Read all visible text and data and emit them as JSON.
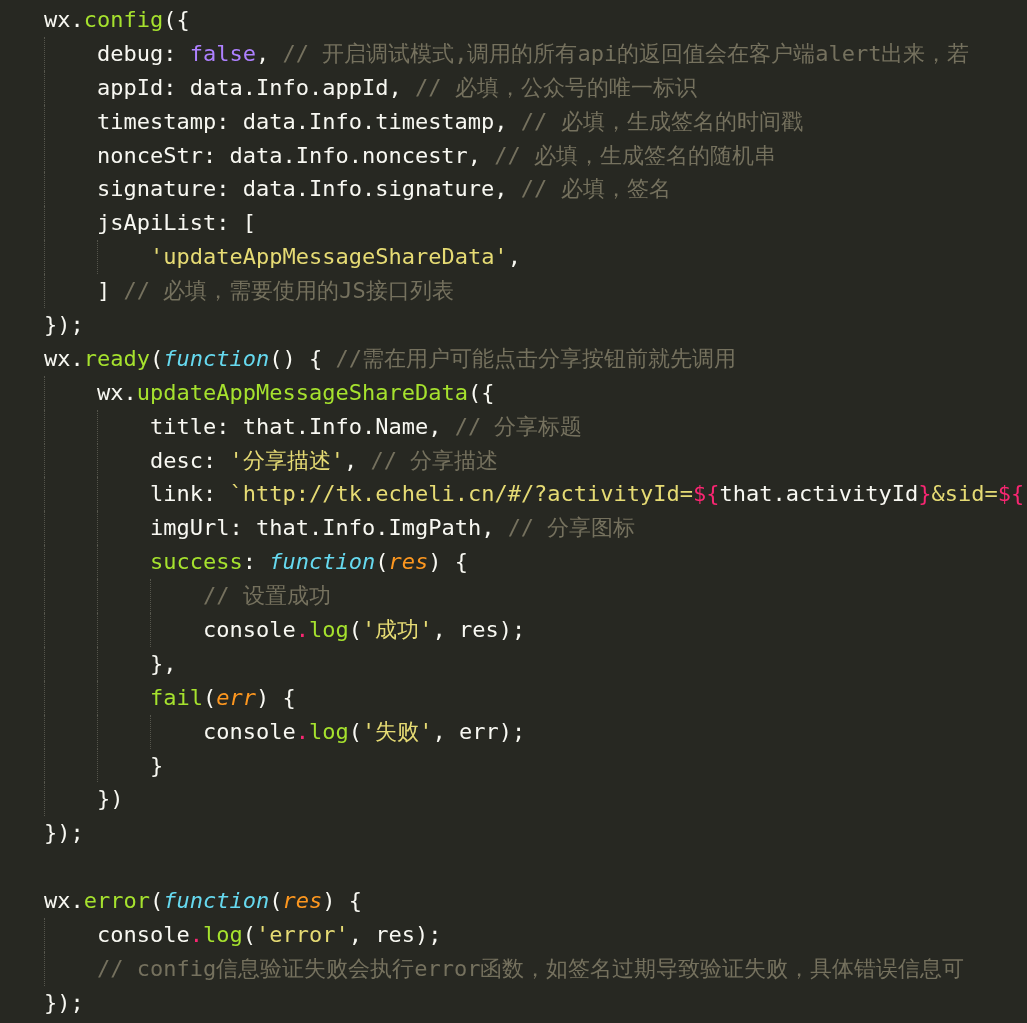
{
  "editor": {
    "lines": [
      {
        "kind": "code",
        "tokens": [
          {
            "text": "wx.",
            "kind": "plain"
          },
          {
            "text": "config",
            "kind": "func"
          },
          {
            "text": "({",
            "kind": "plain"
          }
        ],
        "children": [
          {
            "tokens": [
              {
                "text": "debug: ",
                "kind": "plain"
              },
              {
                "text": "false",
                "kind": "bool"
              },
              {
                "text": ", ",
                "kind": "plain"
              },
              {
                "text": "// 开启调试模式,调用的所有api的返回值会在客户端alert出来，若",
                "kind": "comment"
              }
            ]
          },
          {
            "tokens": [
              {
                "text": "appId: data.Info.appId, ",
                "kind": "plain"
              },
              {
                "text": "// 必填，公众号的唯一标识",
                "kind": "comment"
              }
            ]
          },
          {
            "tokens": [
              {
                "text": "timestamp: data.Info.timestamp, ",
                "kind": "plain"
              },
              {
                "text": "// 必填，生成签名的时间戳",
                "kind": "comment"
              }
            ]
          },
          {
            "tokens": [
              {
                "text": "nonceStr: data.Info.noncestr, ",
                "kind": "plain"
              },
              {
                "text": "// 必填，生成签名的随机串",
                "kind": "comment"
              }
            ]
          },
          {
            "tokens": [
              {
                "text": "signature: data.Info.signature, ",
                "kind": "plain"
              },
              {
                "text": "// 必填，签名",
                "kind": "comment"
              }
            ]
          },
          {
            "tokens": [
              {
                "text": "jsApiList: [",
                "kind": "plain"
              }
            ],
            "children": [
              {
                "tokens": [
                  {
                    "text": "'updateAppMessageShareData'",
                    "kind": "string"
                  },
                  {
                    "text": ",",
                    "kind": "plain"
                  }
                ]
              }
            ]
          },
          {
            "tokens": [
              {
                "text": "] ",
                "kind": "plain"
              },
              {
                "text": "// 必填，需要使用的JS接口列表",
                "kind": "comment"
              }
            ]
          }
        ]
      },
      {
        "kind": "code",
        "tokens": [
          {
            "text": "});",
            "kind": "plain"
          }
        ]
      },
      {
        "kind": "code",
        "tokens": [
          {
            "text": "wx.",
            "kind": "plain"
          },
          {
            "text": "ready",
            "kind": "func"
          },
          {
            "text": "(",
            "kind": "plain"
          },
          {
            "text": "function",
            "kind": "keyword"
          },
          {
            "text": "() { ",
            "kind": "plain"
          },
          {
            "text": "//需在用户可能点击分享按钮前就先调用",
            "kind": "comment"
          }
        ],
        "children": [
          {
            "tokens": [
              {
                "text": "wx.",
                "kind": "plain"
              },
              {
                "text": "updateAppMessageShareData",
                "kind": "func"
              },
              {
                "text": "({",
                "kind": "plain"
              }
            ],
            "children": [
              {
                "tokens": [
                  {
                    "text": "title: that.Info.Name, ",
                    "kind": "plain"
                  },
                  {
                    "text": "// 分享标题",
                    "kind": "comment"
                  }
                ]
              },
              {
                "tokens": [
                  {
                    "text": "desc: ",
                    "kind": "plain"
                  },
                  {
                    "text": "'分享描述'",
                    "kind": "string"
                  },
                  {
                    "text": ", ",
                    "kind": "plain"
                  },
                  {
                    "text": "// 分享描述",
                    "kind": "comment"
                  }
                ]
              },
              {
                "tokens": [
                  {
                    "text": "link: ",
                    "kind": "plain"
                  },
                  {
                    "text": "`http://tk.echeli.cn/#/?activityId=",
                    "kind": "string"
                  },
                  {
                    "text": "${",
                    "kind": "operator"
                  },
                  {
                    "text": "that.activityId",
                    "kind": "plain"
                  },
                  {
                    "text": "}",
                    "kind": "operator"
                  },
                  {
                    "text": "&sid=",
                    "kind": "string"
                  },
                  {
                    "text": "${",
                    "kind": "operator"
                  }
                ]
              },
              {
                "tokens": [
                  {
                    "text": "imgUrl: that.Info.ImgPath, ",
                    "kind": "plain"
                  },
                  {
                    "text": "// 分享图标",
                    "kind": "comment"
                  }
                ]
              },
              {
                "tokens": [
                  {
                    "text": "success",
                    "kind": "func"
                  },
                  {
                    "text": ": ",
                    "kind": "plain"
                  },
                  {
                    "text": "function",
                    "kind": "keyword"
                  },
                  {
                    "text": "(",
                    "kind": "plain"
                  },
                  {
                    "text": "res",
                    "kind": "param"
                  },
                  {
                    "text": ") {",
                    "kind": "plain"
                  }
                ],
                "children": [
                  {
                    "tokens": [
                      {
                        "text": "// 设置成功",
                        "kind": "comment"
                      }
                    ]
                  },
                  {
                    "tokens": [
                      {
                        "text": "console",
                        "kind": "plain"
                      },
                      {
                        "text": ".",
                        "kind": "operator"
                      },
                      {
                        "text": "log",
                        "kind": "func"
                      },
                      {
                        "text": "(",
                        "kind": "plain"
                      },
                      {
                        "text": "'成功'",
                        "kind": "string"
                      },
                      {
                        "text": ", res);",
                        "kind": "plain"
                      }
                    ]
                  }
                ]
              },
              {
                "tokens": [
                  {
                    "text": "},",
                    "kind": "plain"
                  }
                ]
              },
              {
                "tokens": [
                  {
                    "text": "fail",
                    "kind": "func"
                  },
                  {
                    "text": "(",
                    "kind": "plain"
                  },
                  {
                    "text": "err",
                    "kind": "param"
                  },
                  {
                    "text": ") {",
                    "kind": "plain"
                  }
                ],
                "children": [
                  {
                    "tokens": [
                      {
                        "text": "console",
                        "kind": "plain"
                      },
                      {
                        "text": ".",
                        "kind": "operator"
                      },
                      {
                        "text": "log",
                        "kind": "func"
                      },
                      {
                        "text": "(",
                        "kind": "plain"
                      },
                      {
                        "text": "'失败'",
                        "kind": "string"
                      },
                      {
                        "text": ", err);",
                        "kind": "plain"
                      }
                    ]
                  }
                ]
              },
              {
                "tokens": [
                  {
                    "text": "}",
                    "kind": "plain"
                  }
                ]
              }
            ]
          },
          {
            "tokens": [
              {
                "text": "})",
                "kind": "plain"
              }
            ]
          }
        ]
      },
      {
        "kind": "code",
        "tokens": [
          {
            "text": "});",
            "kind": "plain"
          }
        ]
      },
      {
        "kind": "blank"
      },
      {
        "kind": "code",
        "tokens": [
          {
            "text": "wx.",
            "kind": "plain"
          },
          {
            "text": "error",
            "kind": "func"
          },
          {
            "text": "(",
            "kind": "plain"
          },
          {
            "text": "function",
            "kind": "keyword"
          },
          {
            "text": "(",
            "kind": "plain"
          },
          {
            "text": "res",
            "kind": "param"
          },
          {
            "text": ") {",
            "kind": "plain"
          }
        ],
        "children": [
          {
            "tokens": [
              {
                "text": "console",
                "kind": "plain"
              },
              {
                "text": ".",
                "kind": "operator"
              },
              {
                "text": "log",
                "kind": "func"
              },
              {
                "text": "(",
                "kind": "plain"
              },
              {
                "text": "'error'",
                "kind": "string"
              },
              {
                "text": ", res);",
                "kind": "plain"
              }
            ]
          },
          {
            "tokens": [
              {
                "text": "// config信息验证失败会执行error函数，如签名过期导致验证失败，具体错误信息可",
                "kind": "comment"
              }
            ]
          }
        ]
      },
      {
        "kind": "code",
        "tokens": [
          {
            "text": "});",
            "kind": "plain"
          }
        ]
      }
    ]
  }
}
